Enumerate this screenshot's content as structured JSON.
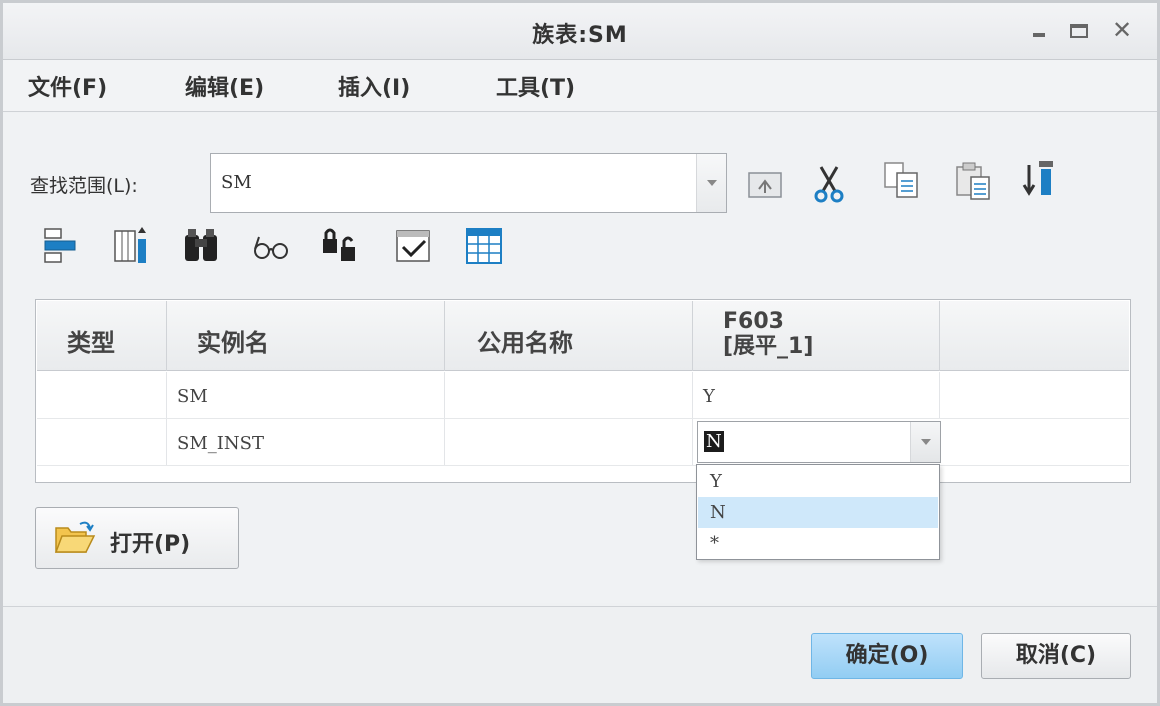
{
  "window": {
    "title": "族表:SM"
  },
  "menu": [
    "文件(F)",
    "编辑(E)",
    "插入(I)",
    "工具(T)"
  ],
  "lookin": {
    "label": "查找范围(L):",
    "value": "SM"
  },
  "toolbar_icons": [
    "folder-up-icon",
    "cut-icon",
    "copy-icon",
    "paste-icon",
    "sort-icon",
    "insert-row-icon",
    "insert-column-icon",
    "find-icon",
    "preview-icon",
    "lock-icon",
    "verify-icon",
    "table-icon"
  ],
  "table": {
    "headers": {
      "type": "类型",
      "instance": "实例名",
      "common": "公用名称",
      "f603_line1": "F603",
      "f603_line2": "[展平_1]"
    },
    "rows": [
      {
        "type": "",
        "instance": "SM",
        "common": "",
        "f603": "Y"
      },
      {
        "type": "",
        "instance": "SM_INST",
        "common": "",
        "f603": "N"
      }
    ]
  },
  "dropdown": {
    "options": [
      "Y",
      "N",
      "*"
    ],
    "selected": "N"
  },
  "buttons": {
    "open": "打开(P)",
    "ok": "确定(O)",
    "cancel": "取消(C)"
  },
  "colors": {
    "ok_button": "#a8d8f6",
    "selected_option": "#cfe8fa"
  }
}
